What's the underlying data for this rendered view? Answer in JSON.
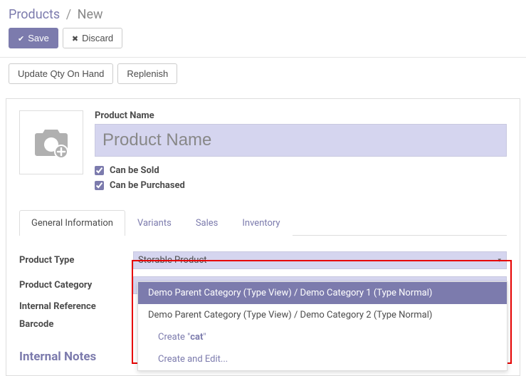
{
  "breadcrumb": {
    "root": "Products",
    "current": "New"
  },
  "buttons": {
    "save": "Save",
    "discard": "Discard",
    "update_qty": "Update Qty On Hand",
    "replenish": "Replenish"
  },
  "product": {
    "name_label": "Product Name",
    "name_placeholder": "Product Name",
    "can_be_sold_label": "Can be Sold",
    "can_be_purchased_label": "Can be Purchased"
  },
  "tabs": {
    "general": "General Information",
    "variants": "Variants",
    "sales": "Sales",
    "inventory": "Inventory"
  },
  "fields": {
    "product_type_label": "Product Type",
    "product_type_value": "Storable Product",
    "product_category_label": "Product Category",
    "product_category_value": "cat",
    "internal_ref_label": "Internal Reference",
    "barcode_label": "Barcode"
  },
  "dropdown": {
    "opt1": "Demo Parent Category (Type View) / Demo Category 1 (Type Normal)",
    "opt2": "Demo Parent Category (Type View) / Demo Category 2 (Type Normal)",
    "create_prefix": "Create \"",
    "create_term": "cat",
    "create_suffix": "\"",
    "create_edit": "Create and Edit..."
  },
  "sections": {
    "internal_notes": "Internal Notes"
  }
}
